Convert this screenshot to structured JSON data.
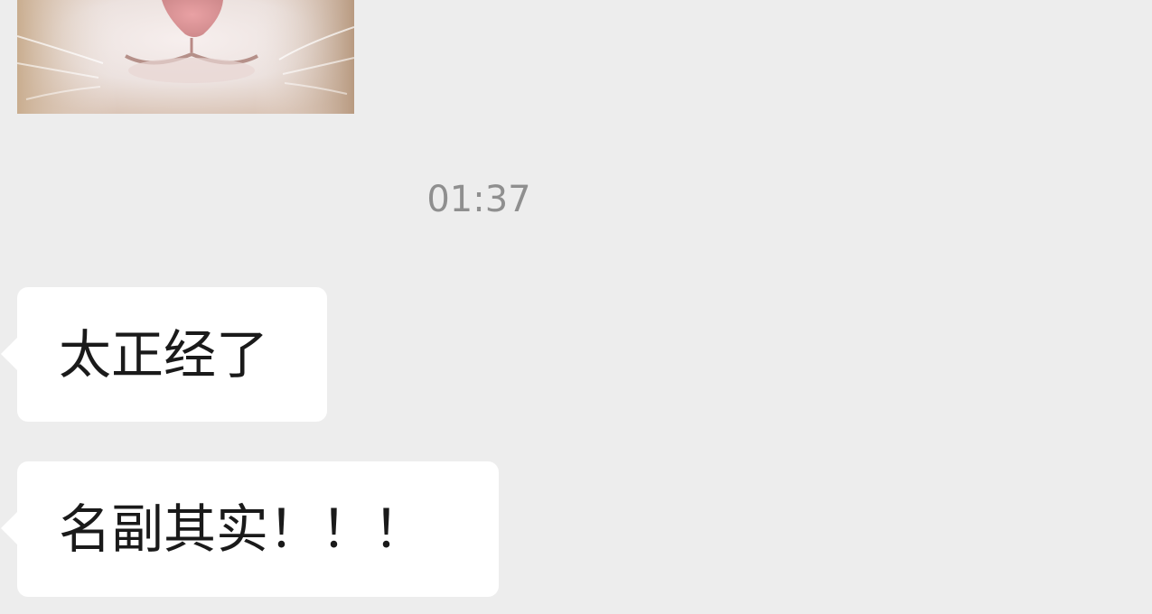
{
  "chat": {
    "image_message": {
      "content": "cat close-up photo"
    },
    "timestamp": "01:37",
    "messages": [
      {
        "text": "太正经了"
      },
      {
        "text": "名副其实！！！"
      }
    ]
  },
  "colors": {
    "background": "#ededed",
    "bubble": "#ffffff",
    "timestamp_text": "#8f8f8f",
    "message_text": "#1a1a1a"
  }
}
